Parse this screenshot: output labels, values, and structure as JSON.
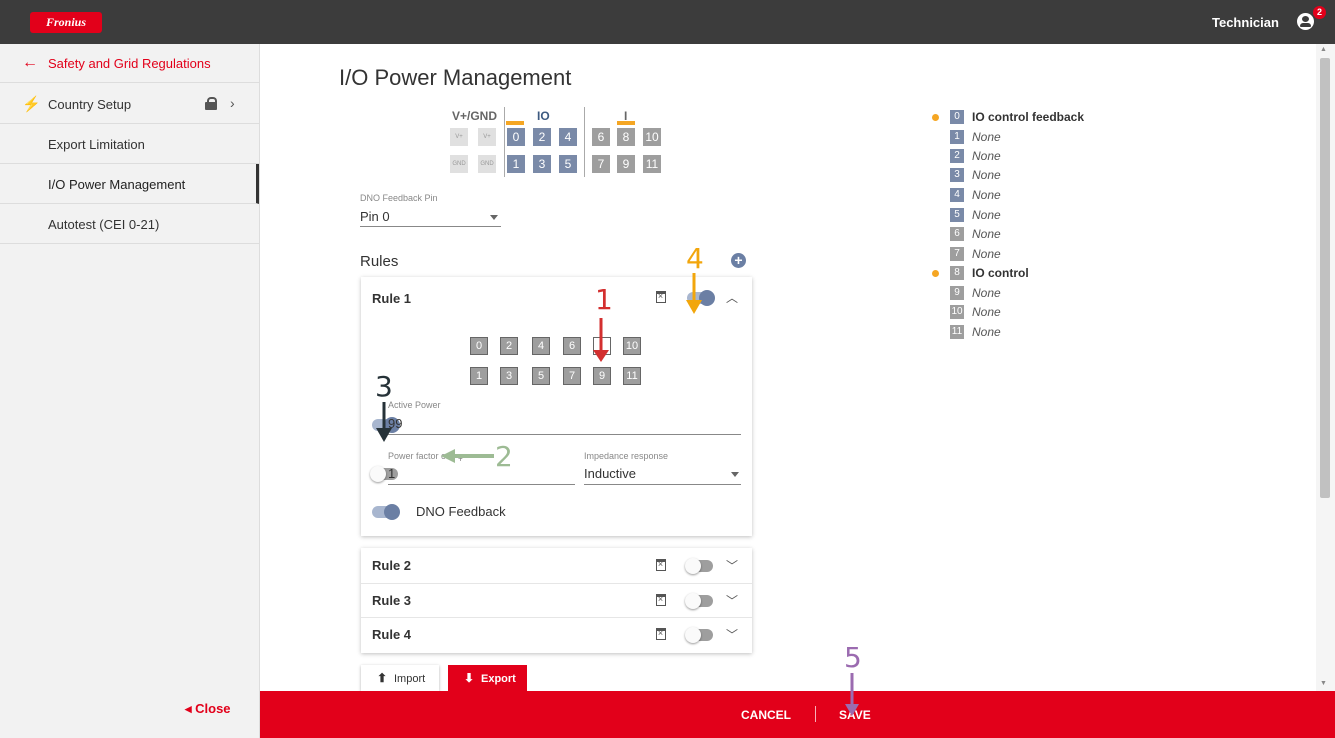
{
  "header": {
    "logo_text": "Fronius",
    "user": "Technician",
    "notification_count": "2"
  },
  "sidebar": {
    "back_label": "Safety and Grid Regulations",
    "items": [
      {
        "label": "Country Setup",
        "icon": "tower-icon",
        "locked": true
      },
      {
        "label": "Export Limitation"
      },
      {
        "label": "I/O Power Management",
        "active": true
      },
      {
        "label": "Autotest (CEI 0-21)"
      }
    ],
    "close_label": "Close"
  },
  "main": {
    "title": "I/O Power Management",
    "pins": {
      "heads": [
        "V+/GND",
        "IO",
        "I"
      ],
      "power_top": [
        "V+",
        "V+"
      ],
      "power_bottom": [
        "GND",
        "GND"
      ],
      "top": [
        "0",
        "2",
        "4",
        "6",
        "8",
        "10"
      ],
      "bottom": [
        "1",
        "3",
        "5",
        "7",
        "9",
        "11"
      ]
    },
    "dno_pin": {
      "label": "DNO Feedback Pin",
      "value": "Pin 0"
    },
    "rules_title": "Rules",
    "rules": [
      {
        "name": "Rule 1",
        "expanded": true,
        "enabled": true,
        "pins_top": [
          "0",
          "2",
          "4",
          "6",
          "8",
          "10"
        ],
        "pins_bottom": [
          "1",
          "3",
          "5",
          "7",
          "9",
          "11"
        ],
        "active_power": {
          "label": "Active Power",
          "value": "99",
          "enabled": true
        },
        "power_factor": {
          "label": "Power factor cos φ",
          "value": "1",
          "enabled": false
        },
        "impedance": {
          "label": "Impedance response",
          "value": "Inductive"
        },
        "dno_feedback": {
          "label": "DNO Feedback",
          "enabled": true
        }
      },
      {
        "name": "Rule 2",
        "enabled": false
      },
      {
        "name": "Rule 3",
        "enabled": false
      },
      {
        "name": "Rule 4",
        "enabled": false
      }
    ],
    "import_label": "Import",
    "export_label": "Export"
  },
  "legend": [
    {
      "pin": "0",
      "text": "IO control feedback",
      "bold": true,
      "dot": true
    },
    {
      "pin": "1",
      "text": "None"
    },
    {
      "pin": "2",
      "text": "None"
    },
    {
      "pin": "3",
      "text": "None"
    },
    {
      "pin": "4",
      "text": "None"
    },
    {
      "pin": "5",
      "text": "None"
    },
    {
      "pin": "6",
      "text": "None"
    },
    {
      "pin": "7",
      "text": "None"
    },
    {
      "pin": "8",
      "text": "IO control",
      "bold": true,
      "dot": true
    },
    {
      "pin": "9",
      "text": "None"
    },
    {
      "pin": "10",
      "text": "None"
    },
    {
      "pin": "11",
      "text": "None"
    }
  ],
  "footer": {
    "cancel": "CANCEL",
    "save": "SAVE"
  },
  "annotations": [
    "1",
    "2",
    "3",
    "4",
    "5"
  ],
  "colors": {
    "brand_red": "#e2001a",
    "accent_orange": "#f5a623",
    "pin_blue": "#7a8aa8",
    "pin_gray": "#9e9e9e"
  }
}
